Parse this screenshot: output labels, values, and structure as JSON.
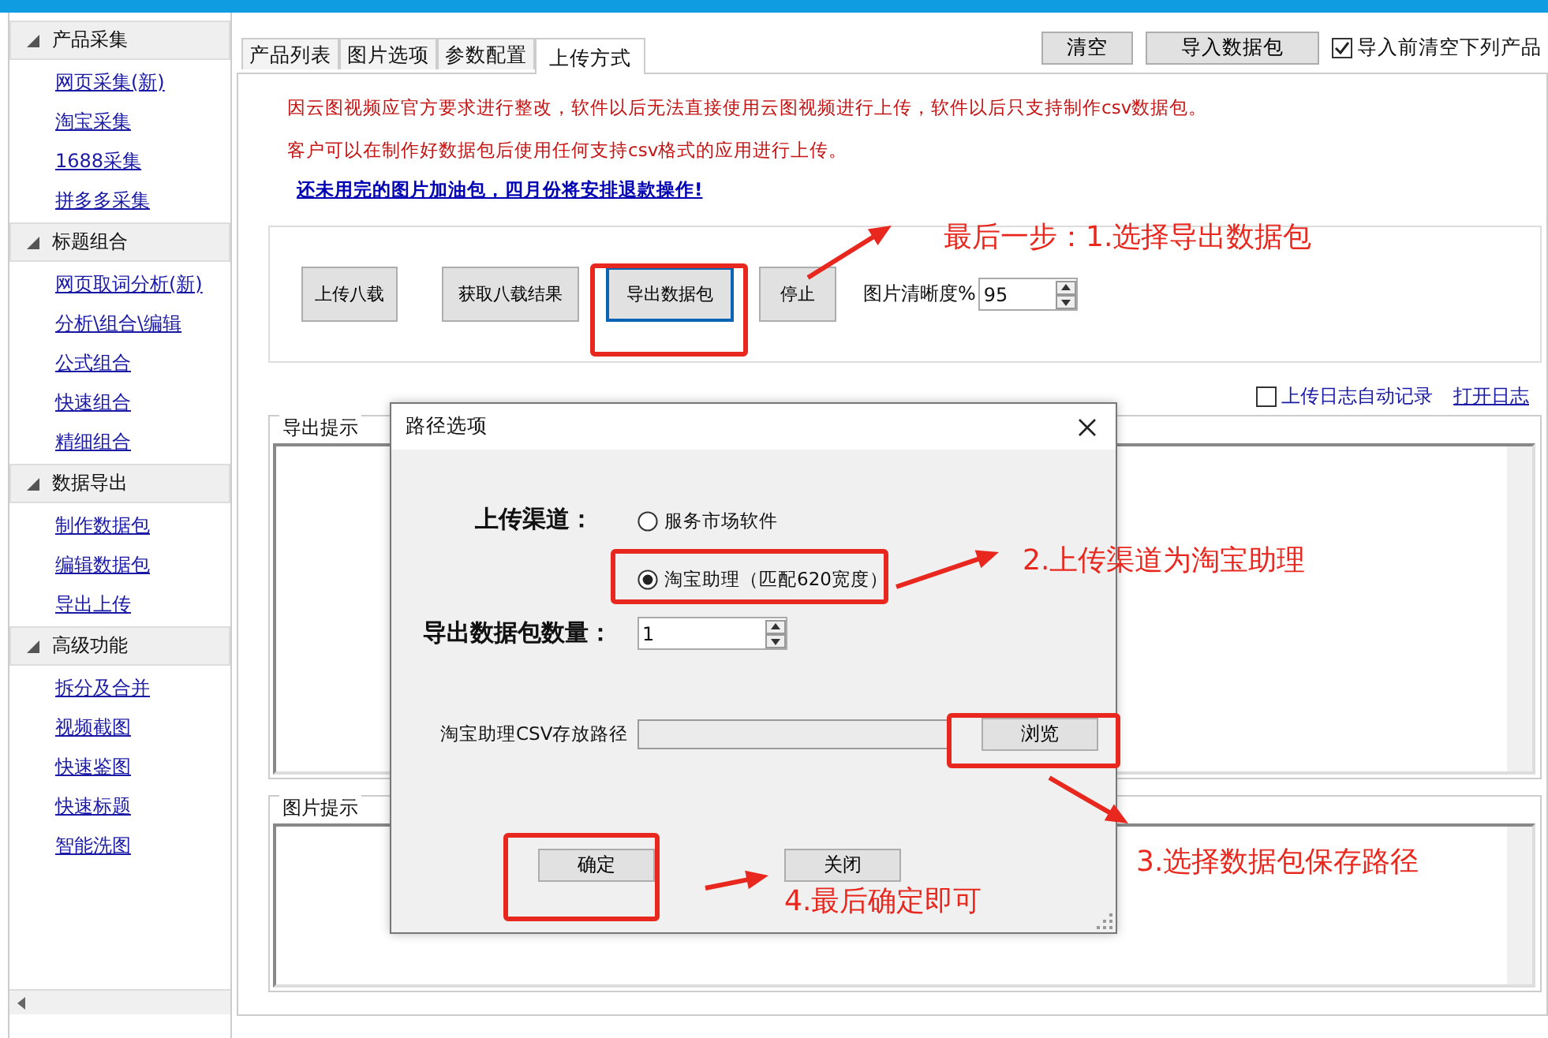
{
  "sidebar": {
    "groups": [
      {
        "title": "产品采集",
        "expanded": true,
        "items": [
          "网页采集(新)",
          "淘宝采集",
          "1688采集",
          "拼多多采集"
        ]
      },
      {
        "title": "标题组合",
        "expanded": true,
        "items": [
          "网页取词分析(新)",
          "分析\\组合\\编辑",
          "公式组合",
          "快速组合",
          "精细组合"
        ]
      },
      {
        "title": "数据导出",
        "expanded": true,
        "items": [
          "制作数据包",
          "编辑数据包",
          "导出上传"
        ]
      },
      {
        "title": "高级功能",
        "expanded": true,
        "items": [
          "拆分及合并",
          "视频截图",
          "快速鉴图",
          "快速标题",
          "智能洗图"
        ]
      }
    ]
  },
  "tabs": [
    {
      "label": "产品列表",
      "selected": false
    },
    {
      "label": "图片选项",
      "selected": false
    },
    {
      "label": "参数配置",
      "selected": false
    },
    {
      "label": "上传方式",
      "selected": true
    }
  ],
  "top_buttons": [
    "清空",
    "导入数据包"
  ],
  "clear_before_import": {
    "label": "导入前清空下列产品",
    "checked": true
  },
  "notices": [
    {
      "kind": "warning",
      "text": "因云图视频应官方要求进行整改，软件以后无法直接使用云图视频进行上传，软件以后只支持制作csv数据包。"
    },
    {
      "kind": "warning",
      "text": "客户可以在制作好数据包后使用任何支持csv格式的应用进行上传。"
    },
    {
      "kind": "link",
      "text": "还未用完的图片加油包，四月份将安排退款操作!"
    }
  ],
  "action_buttons": [
    {
      "label": "上传八载",
      "focused": false
    },
    {
      "label": "获取八载结果",
      "focused": false
    },
    {
      "label": "导出数据包",
      "focused": true
    },
    {
      "label": "停止",
      "focused": false
    }
  ],
  "quality": {
    "label": "图片清晰度%",
    "value": "95"
  },
  "log": {
    "auto_record": {
      "label": "上传日志自动记录",
      "checked": false
    },
    "open_link": "打开日志"
  },
  "export_hint": {
    "title": "导出提示"
  },
  "image_hint": {
    "title": "图片提示"
  },
  "dialog": {
    "title": "路径选项",
    "channel_label": "上传渠道：",
    "channels": [
      {
        "label": "服务市场软件",
        "selected": false
      },
      {
        "label": "淘宝助理（匹配620宽度）",
        "selected": true
      }
    ],
    "count_label": "导出数据包数量：",
    "count_value": "1",
    "path_label": "淘宝助理CSV存放路径",
    "browse": "浏览",
    "ok": "确定",
    "close": "关闭"
  },
  "annotations": [
    {
      "text": "最后一步：1.选择导出数据包"
    },
    {
      "text": "2.上传渠道为淘宝助理"
    },
    {
      "text": "3.选择数据包保存路径"
    },
    {
      "text": "4.最后确定即可"
    }
  ]
}
